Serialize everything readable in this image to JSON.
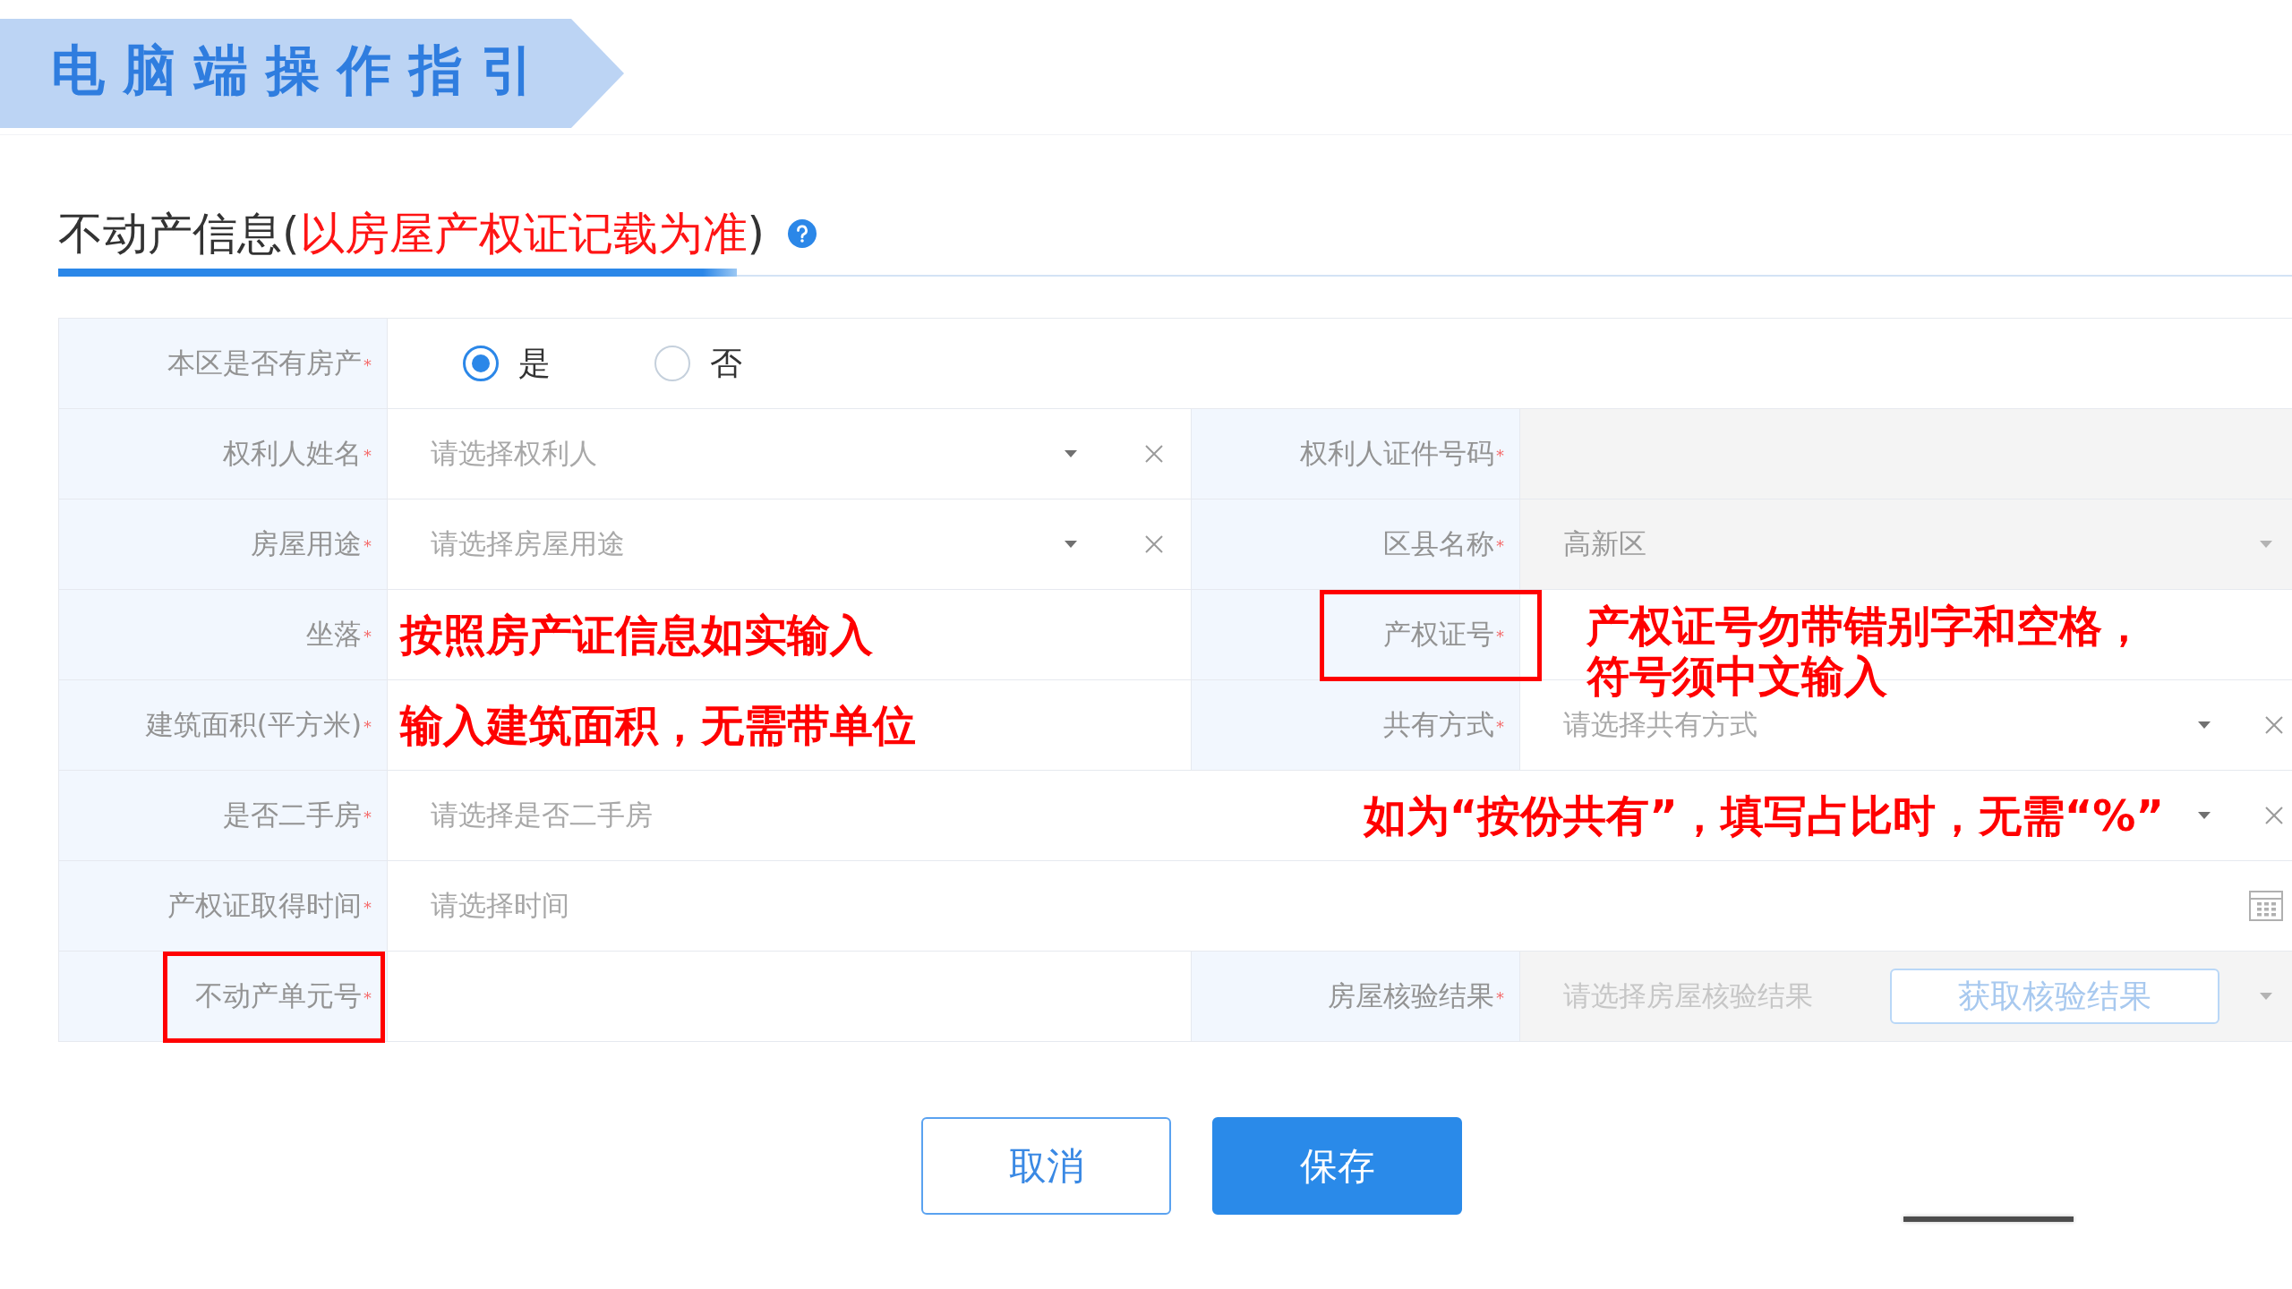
{
  "banner": {
    "title": "电脑端操作指引"
  },
  "section": {
    "title_parts": [
      {
        "text": "不动产信息(",
        "kind": "plain"
      },
      {
        "text": "以房屋产权证记载为准",
        "kind": "emphasis"
      },
      {
        "text": ")",
        "kind": "plain"
      }
    ]
  },
  "form": {
    "rows": [
      {
        "fields": [
          {
            "label": "本区是否有房产",
            "required_mark": "*",
            "kind": "radio",
            "disabled": false,
            "highlighted": false,
            "clearable": false,
            "options": [
              {
                "label": "是",
                "selected": true
              },
              {
                "label": "否",
                "selected": false
              }
            ]
          }
        ]
      },
      {
        "fields": [
          {
            "label": "权利人姓名",
            "required_mark": "*",
            "kind": "select",
            "placeholder": "请选择权利人",
            "disabled": false,
            "highlighted": false,
            "clearable": true
          },
          {
            "label": "权利人证件号码",
            "required_mark": "*",
            "kind": "input",
            "disabled": true,
            "highlighted": false,
            "clearable": false
          }
        ]
      },
      {
        "fields": [
          {
            "label": "房屋用途",
            "required_mark": "*",
            "kind": "select",
            "placeholder": "请选择房屋用途",
            "disabled": false,
            "highlighted": false,
            "clearable": true
          },
          {
            "label": "区县名称",
            "required_mark": "*",
            "kind": "select",
            "value": "高新区",
            "disabled": true,
            "highlighted": false,
            "clearable": false
          }
        ]
      },
      {
        "fields": [
          {
            "label": "坐落",
            "required_mark": "*",
            "kind": "input",
            "note": "按照房产证信息如实输入",
            "highlighted": false,
            "clearable": false
          },
          {
            "label": "产权证号",
            "required_mark": "*",
            "kind": "input",
            "note": "产权证号勿带错别字和空格，符号须中文输入",
            "highlighted": true,
            "clearable": false
          }
        ]
      },
      {
        "fields": [
          {
            "label": "建筑面积(平方米)",
            "required_mark": "*",
            "kind": "input",
            "note": "输入建筑面积，无需带单位",
            "highlighted": false,
            "clearable": false
          },
          {
            "label": "共有方式",
            "required_mark": "*",
            "kind": "select",
            "placeholder": "请选择共有方式",
            "disabled": false,
            "highlighted": false,
            "clearable": true
          }
        ]
      },
      {
        "fields": [
          {
            "label": "是否二手房",
            "required_mark": "*",
            "kind": "select",
            "placeholder": "请选择是否二手房",
            "note": "如为“按份共有”，填写占比时，无需“%”",
            "disabled": false,
            "highlighted": false,
            "clearable": true
          }
        ]
      },
      {
        "fields": [
          {
            "label": "产权证取得时间",
            "required_mark": "*",
            "kind": "date",
            "placeholder": "请选择时间",
            "disabled": false,
            "highlighted": false,
            "clearable": false
          }
        ]
      },
      {
        "fields": [
          {
            "label": "不动产单元号",
            "required_mark": "*",
            "kind": "input",
            "disabled": false,
            "highlighted": true,
            "clearable": false
          },
          {
            "label": "房屋核验结果",
            "required_mark": "*",
            "kind": "verify",
            "placeholder": "请选择房屋核验结果",
            "disabled": true,
            "highlighted": false,
            "clearable": false,
            "action": {
              "label": "获取核验结果",
              "disabled": true
            }
          }
        ]
      }
    ]
  },
  "buttons": [
    {
      "label": "取消",
      "kind": "secondary"
    },
    {
      "label": "保存",
      "kind": "primary"
    }
  ]
}
